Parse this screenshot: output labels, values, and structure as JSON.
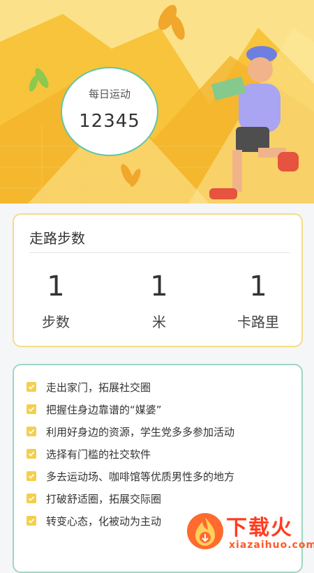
{
  "hero": {
    "daily_title": "每日运动",
    "daily_value": "12345"
  },
  "walk_card": {
    "title": "走路步数",
    "stats": [
      {
        "value": "1",
        "label": "步数"
      },
      {
        "value": "1",
        "label": "米"
      },
      {
        "value": "1",
        "label": "卡路里"
      }
    ]
  },
  "tips": [
    "走出家门，拓展社交圈",
    "把握住身边靠谱的“媒婆”",
    "利用好身边的资源，学生党多多参加活动",
    "选择有门槛的社交软件",
    "多去运动场、咖啡馆等优质男性多的地方",
    "打破舒适圈，拓展交际圈",
    "转变心态，化被动为主动"
  ],
  "watermark": {
    "brand": "下载火",
    "domain": "xiazaihuo.com"
  },
  "colors": {
    "hero_yellow": "#f7c43b",
    "accent_green": "#5fc6a6",
    "check_yellow": "#f5cf4c",
    "watermark_orange": "#ff3d1f"
  }
}
